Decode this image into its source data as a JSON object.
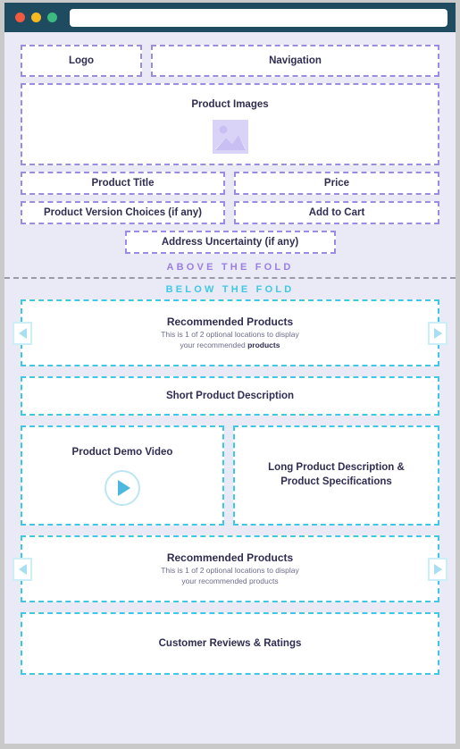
{
  "browser": {
    "traffic_lights": [
      "close-red",
      "minimize-yellow",
      "maximize-green"
    ],
    "address_bar_value": "",
    "address_bar_placeholder": "",
    "chrome_color": "#1e4b5f"
  },
  "colors": {
    "page_background": "#e9eaf6",
    "outer_frame": "#c9c9c9",
    "above_fold_border": "#9b8ce0",
    "below_fold_border": "#3fc8e4",
    "above_fold_label": "#9b7fe0",
    "below_fold_label": "#3fc8e4",
    "heading_text": "#2f2d52",
    "body_text": "#6b6b8c",
    "fold_divider": "#9a9aa8"
  },
  "above_fold": {
    "logo": "Logo",
    "navigation": "Navigation",
    "product_images": {
      "label": "Product Images",
      "icon": "image-placeholder-icon"
    },
    "product_title": "Product Title",
    "price": "Price",
    "product_version_choices": "Product Version Choices (if any)",
    "add_to_cart": "Add to Cart",
    "address_uncertainty": "Address Uncertainty (if any)"
  },
  "fold": {
    "above_label": "ABOVE THE FOLD",
    "below_label": "BELOW THE FOLD"
  },
  "below_fold": {
    "recommended_top": {
      "title": "Recommended Products",
      "subtitle_line1": "This is 1 of 2 optional locations to display",
      "subtitle_line2_prefix": "your recommended ",
      "subtitle_line2_emphasis": "products",
      "prev_arrow": "carousel-prev",
      "next_arrow": "carousel-next"
    },
    "short_product_description": "Short Product Description",
    "product_demo_video": {
      "label": "Product Demo Video",
      "play_button": "play-icon"
    },
    "long_product_description": {
      "line1": "Long Product Description &",
      "line2": "Product Specifications"
    },
    "recommended_bottom": {
      "title": "Recommended Products",
      "subtitle_line1": "This is 1 of 2 optional locations to display",
      "subtitle_line2": "your recommended products",
      "prev_arrow": "carousel-prev",
      "next_arrow": "carousel-next"
    },
    "customer_reviews": "Customer Reviews & Ratings"
  }
}
